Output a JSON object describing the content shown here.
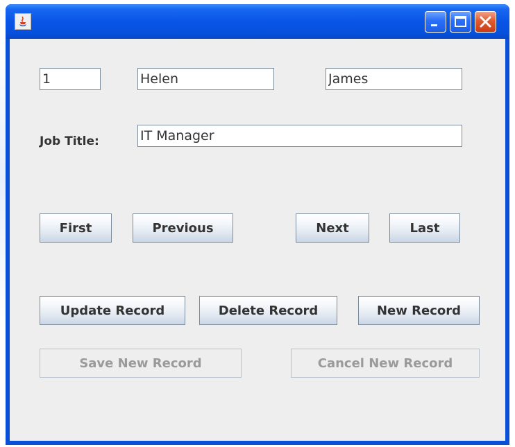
{
  "window": {
    "title": "",
    "controls": {
      "minimize_icon": "minimize-icon",
      "maximize_icon": "maximize-icon",
      "close_icon": "close-icon"
    }
  },
  "form": {
    "id_value": "1",
    "first_name_value": "Helen",
    "last_name_value": "James",
    "job_title_label": "Job Title:",
    "job_title_value": "IT Manager"
  },
  "navigation": {
    "first_label": "First",
    "previous_label": "Previous",
    "next_label": "Next",
    "last_label": "Last"
  },
  "actions": {
    "update_label": "Update Record",
    "delete_label": "Delete Record",
    "new_label": "New Record",
    "save_new_label": "Save New Record",
    "cancel_new_label": "Cancel New Record"
  },
  "colors": {
    "titlebar": "#0a55e6",
    "close_button": "#e2592f",
    "client_background": "#eeeeee",
    "disabled_text": "#9a9a9a"
  }
}
